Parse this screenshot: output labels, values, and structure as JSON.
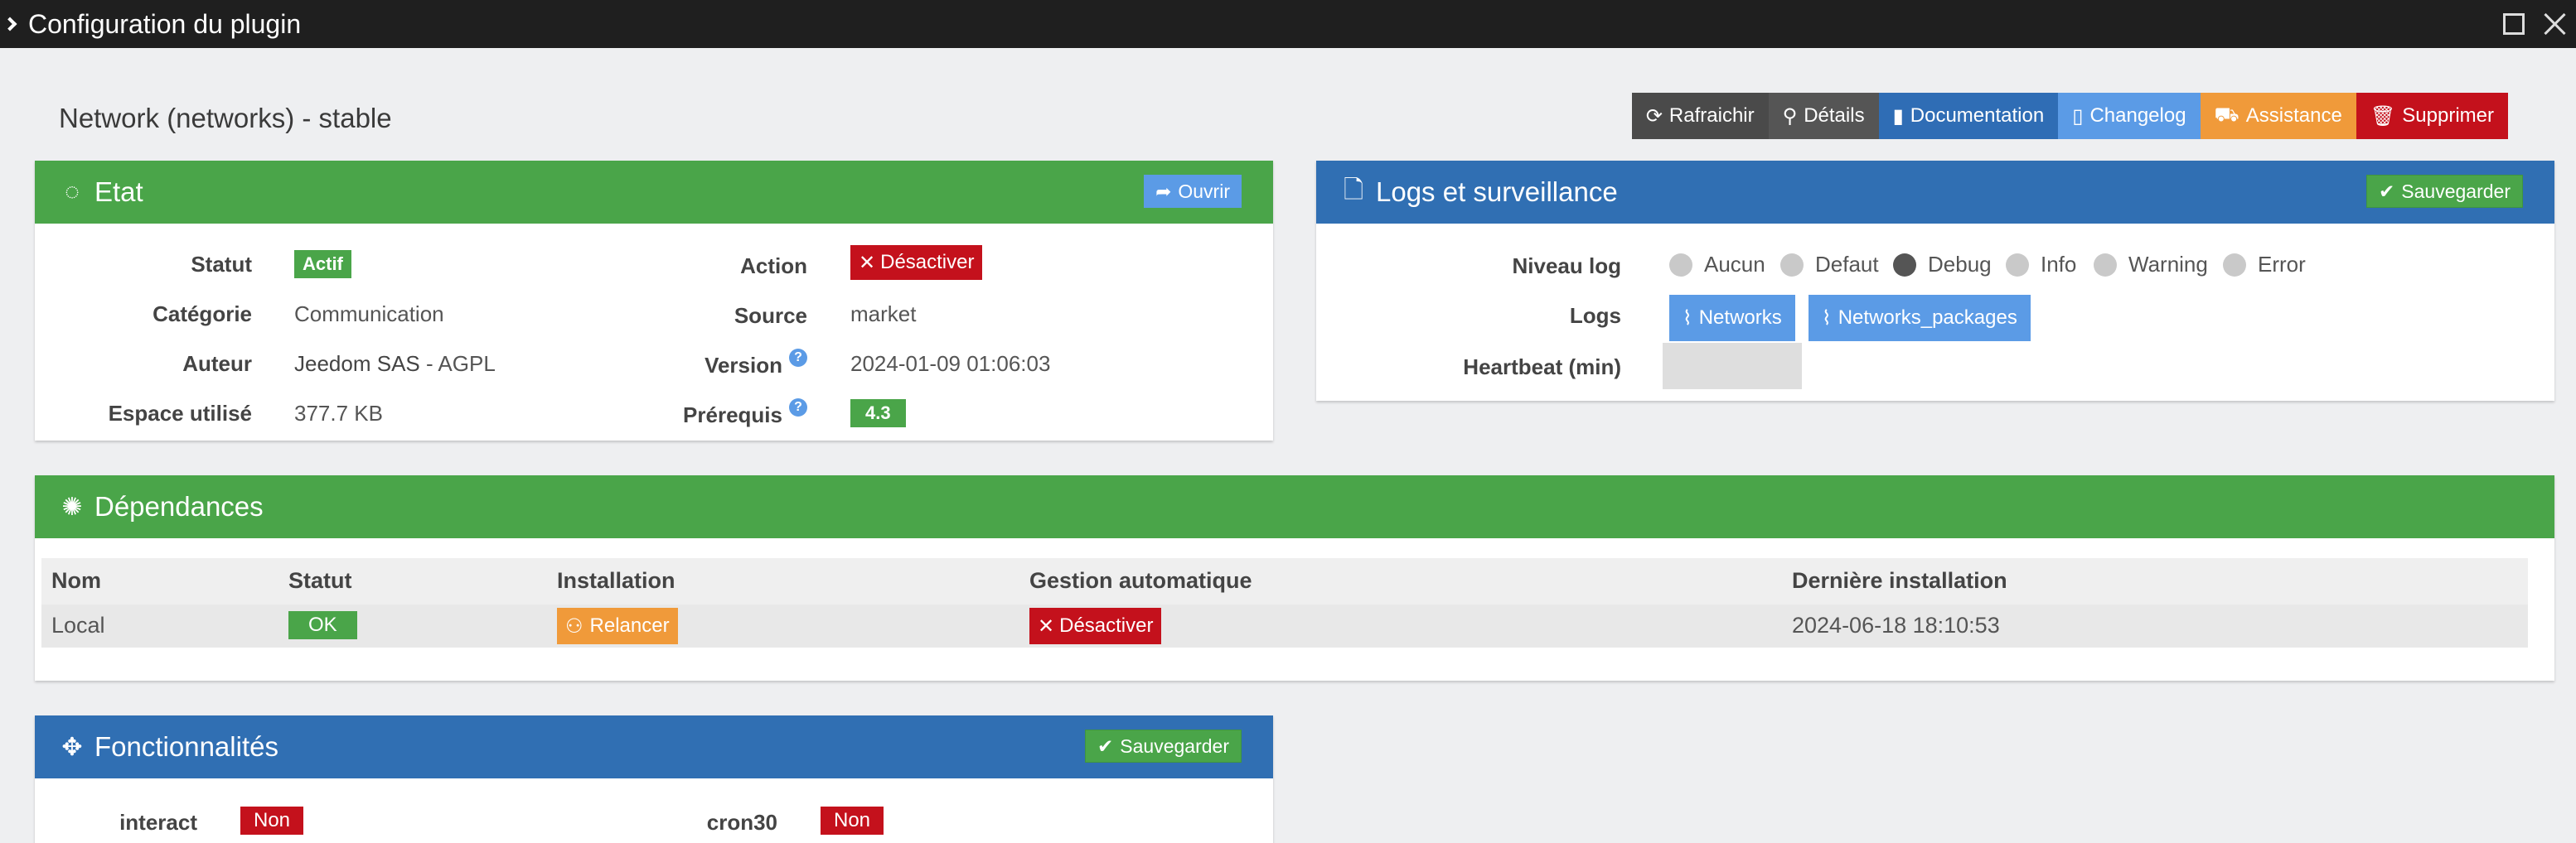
{
  "window": {
    "title": "Configuration du plugin"
  },
  "plugin": {
    "name": "Network (networks) - stable"
  },
  "toolbar": {
    "refresh": "Rafraichir",
    "details": "Détails",
    "documentation": "Documentation",
    "changelog": "Changelog",
    "assistance": "Assistance",
    "delete": "Supprimer"
  },
  "etat": {
    "title": "Etat",
    "open_button": "Ouvrir",
    "statut_label": "Statut",
    "statut_value": "Actif",
    "categorie_label": "Catégorie",
    "categorie_value": "Communication",
    "auteur_label": "Auteur",
    "auteur_name": "Jeedom SAS",
    "auteur_license": " - AGPL",
    "espace_label": "Espace utilisé",
    "espace_value": "377.7 KB",
    "action_label": "Action",
    "action_button": "Désactiver",
    "source_label": "Source",
    "source_value": "market",
    "version_label": "Version",
    "version_value": "2024-01-09 01:06:03",
    "prerequis_label": "Prérequis",
    "prerequis_value": "4.3"
  },
  "logs": {
    "title": "Logs et surveillance",
    "save_button": "Sauvegarder",
    "niveau_label": "Niveau log",
    "levels": [
      "Aucun",
      "Defaut",
      "Debug",
      "Info",
      "Warning",
      "Error"
    ],
    "selected_level": "Debug",
    "logs_label": "Logs",
    "log_files": [
      "Networks",
      "Networks_packages"
    ],
    "heartbeat_label": "Heartbeat (min)",
    "heartbeat_value": ""
  },
  "dependances": {
    "title": "Dépendances",
    "columns": [
      "Nom",
      "Statut",
      "Installation",
      "Gestion automatique",
      "Dernière installation"
    ],
    "row": {
      "nom": "Local",
      "statut": "OK",
      "installation": "Relancer",
      "gestion": "Désactiver",
      "derniere": "2024-06-18 18:10:53"
    }
  },
  "fonctionnalites": {
    "title": "Fonctionnalités",
    "save_button": "Sauvegarder",
    "interact_label": "interact",
    "interact_value": "Non",
    "cron30_label": "cron30",
    "cron30_value": "Non"
  },
  "colors": {
    "green": "#4aa549",
    "blue": "#306fb3",
    "light_blue": "#5b9be6",
    "orange": "#f09a3a",
    "red": "#c4111c",
    "dark": "#4a4a4a",
    "titlebar": "#1f1f1f"
  }
}
